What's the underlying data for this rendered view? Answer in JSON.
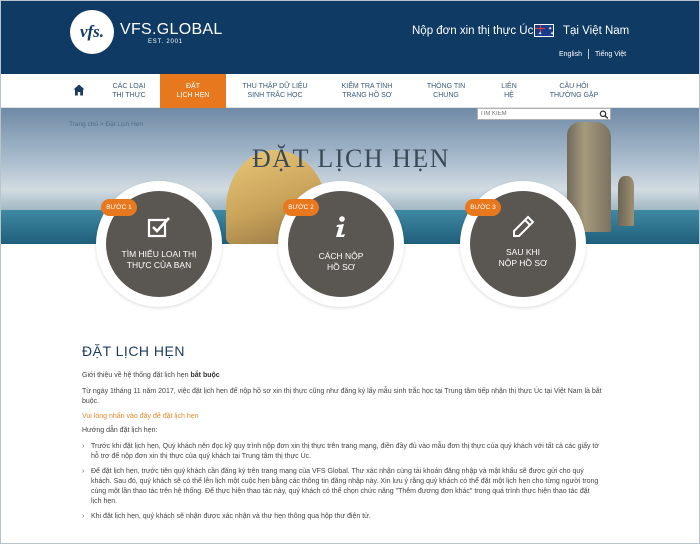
{
  "header": {
    "logo_text": "vfs.",
    "brand": "VFS.GLOBAL",
    "brand_sub": "EST. 2001",
    "visa_title": "Nộp đơn xin thị thực Úc",
    "country": "Tại Việt Nam",
    "lang_en": "English",
    "lang_vi": "Tiếng Việt"
  },
  "nav": {
    "items": [
      {
        "line1": "CÁC LOẠI",
        "line2": "THỊ THỰC"
      },
      {
        "line1": "ĐẶT",
        "line2": "LỊCH HẸN"
      },
      {
        "line1": "THU THẬP DỮ LIỆU",
        "line2": "SINH TRẮC HỌC"
      },
      {
        "line1": "KIỂM TRA TÌNH",
        "line2": "TRẠNG HỒ SƠ"
      },
      {
        "line1": "THÔNG TIN",
        "line2": "CHUNG"
      },
      {
        "line1": "LIÊN",
        "line2": "HỆ"
      },
      {
        "line1": "CÂU HỎI",
        "line2": "THƯỜNG GẶP"
      }
    ]
  },
  "hero": {
    "breadcrumb": "Trang chủ > Đặt Lịch Hẹn",
    "search_placeholder": "TÌM KIẾM",
    "title": "ĐẶT LỊCH HẸN"
  },
  "steps": [
    {
      "badge": "BƯỚC 1",
      "line1": "TÌM HIỂU LOẠI THỊ",
      "line2": "THỰC CỦA BẠN",
      "icon": "checkbox-icon"
    },
    {
      "badge": "BƯỚC 2",
      "line1": "CÁCH NỘP",
      "line2": "HỒ SƠ",
      "icon": "info-icon"
    },
    {
      "badge": "BƯỚC 3",
      "line1": "SAU KHI",
      "line2": "NỘP HỒ SƠ",
      "icon": "pencil-icon"
    }
  ],
  "content": {
    "heading": "ĐẶT LỊCH HẸN",
    "intro_prefix": "Giới thiệu về hệ thống đặt lịch hẹn ",
    "intro_bold": "bắt buộc",
    "para1": "Từ ngày 1tháng 11 năm 2017, việc đặt lịch hẹn để nộp hồ sơ xin thị thực cũng như đăng ký lấy mẫu sinh trắc học tại Trung tâm tiếp nhận thị thực Úc tại Việt Nam là bắt buộc.",
    "link": "Vui lòng nhấn vào đây để đặt lịch hẹn",
    "guide": "Hướng dẫn đặt lịch hẹn:",
    "bullets": [
      "Trước khi đặt lịch hẹn, Quý khách nên đọc kỹ quy trình nộp đơn xin thị thực trên trang mạng, điền đầy đủ vào mẫu đơn thị thực của quý khách với tất cả các giấy tờ hỗ trợ để nộp đơn xin thị thực của quý khách tại Trung tâm thị thực Úc.",
      "Để đặt lịch hẹn, trước tiên quý khách cần đăng ký trên trang mạng của VFS Global. Thư xác nhận cùng tài khoản đăng nhập và mật khẩu sẽ được gửi cho quý khách. Sau đó, quý khách sẽ có thể lên lịch một cuộc hẹn bằng các thông tin đăng nhập này. Xin lưu ý rằng quý khách có thể đặt một lịch hẹn cho từng người trong cùng một lần thao tác trên hệ thống. Để thực hiện thao tác này, quý khách có thể chọn chức năng \"Thêm đương đơn khác\" trong quá trình thực hiện thao tác đặt lịch hẹn.",
      "Khi đặt lịch hẹn, quý khách sẽ nhận được xác nhận và thư hẹn thông qua hộp thư điện tử."
    ]
  },
  "colors": {
    "header_bg": "#0e3a64",
    "accent": "#e8781e",
    "step_bg": "#5a5752"
  }
}
